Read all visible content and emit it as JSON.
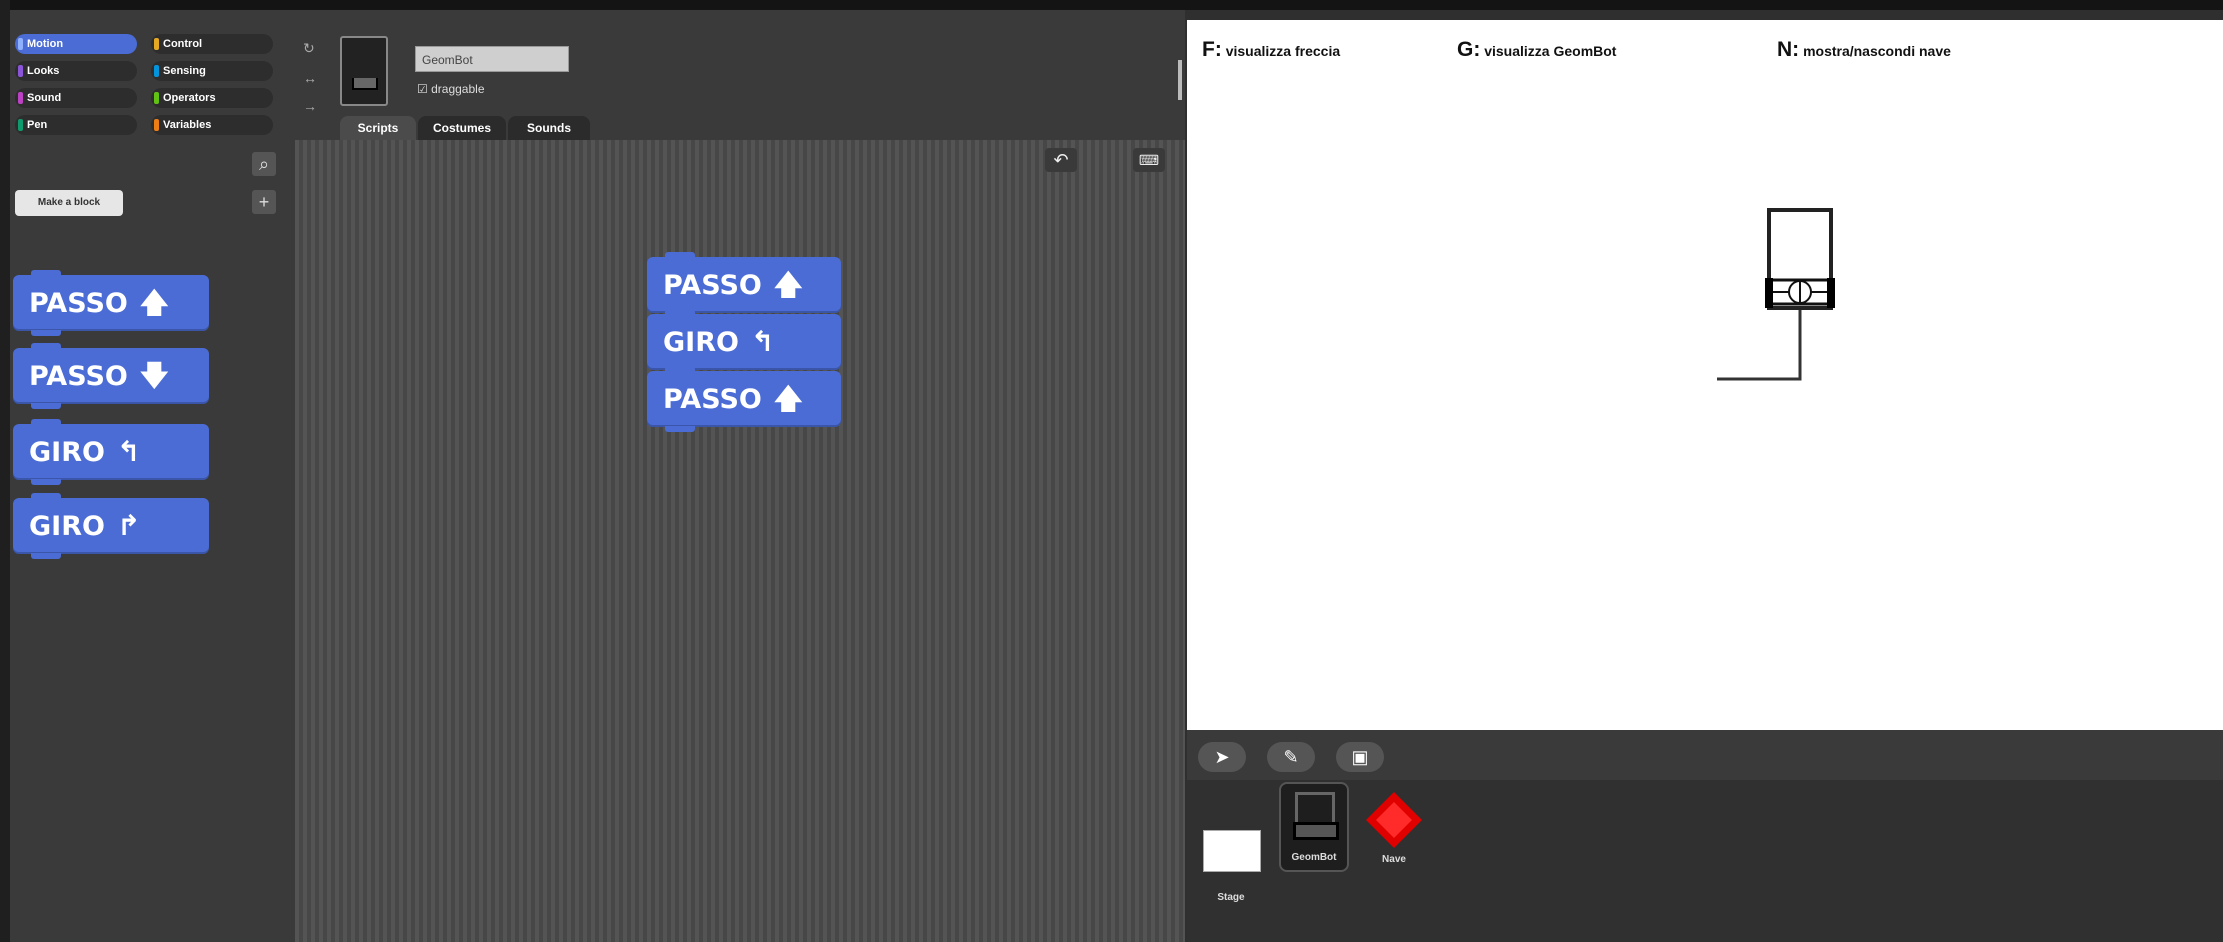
{
  "categories": [
    {
      "label": "Motion",
      "color": "#4a6cd4",
      "selected": true
    },
    {
      "label": "Looks",
      "color": "#8a55d7"
    },
    {
      "label": "Sound",
      "color": "#bb42c3"
    },
    {
      "label": "Pen",
      "color": "#0e9a6c"
    },
    {
      "label": "Control",
      "color": "#e6a822"
    },
    {
      "label": "Sensing",
      "color": "#0494dc"
    },
    {
      "label": "Operators",
      "color": "#62c213"
    },
    {
      "label": "Variables",
      "color": "#ee7d16"
    }
  ],
  "palette": {
    "make_block_label": "Make a block",
    "blocks": [
      {
        "label": "PASSO",
        "icon": "arrow-up-icon"
      },
      {
        "label": "PASSO",
        "icon": "arrow-down-icon"
      },
      {
        "label": "GIRO",
        "icon": "turn-left-icon"
      },
      {
        "label": "GIRO",
        "icon": "turn-right-icon"
      }
    ]
  },
  "sprite": {
    "name": "GeomBot",
    "draggable_label": "draggable"
  },
  "tabs": [
    "Scripts",
    "Costumes",
    "Sounds"
  ],
  "script": [
    {
      "label": "PASSO",
      "icon": "arrow-up-icon"
    },
    {
      "label": "GIRO",
      "icon": "turn-left-icon"
    },
    {
      "label": "PASSO",
      "icon": "arrow-up-icon"
    }
  ],
  "stage": {
    "hints": [
      {
        "key": "F:",
        "text": "visualizza freccia"
      },
      {
        "key": "G:",
        "text": "visualizza GeomBot"
      },
      {
        "key": "N:",
        "text": "mostra/nascondi nave"
      }
    ]
  },
  "corral": {
    "stage_label": "Stage",
    "sprites": [
      "GeomBot",
      "Nave"
    ]
  },
  "colors": {
    "accent": "#4a6cd4",
    "stage_bg": "#ffffff",
    "nave": "#e00000"
  }
}
